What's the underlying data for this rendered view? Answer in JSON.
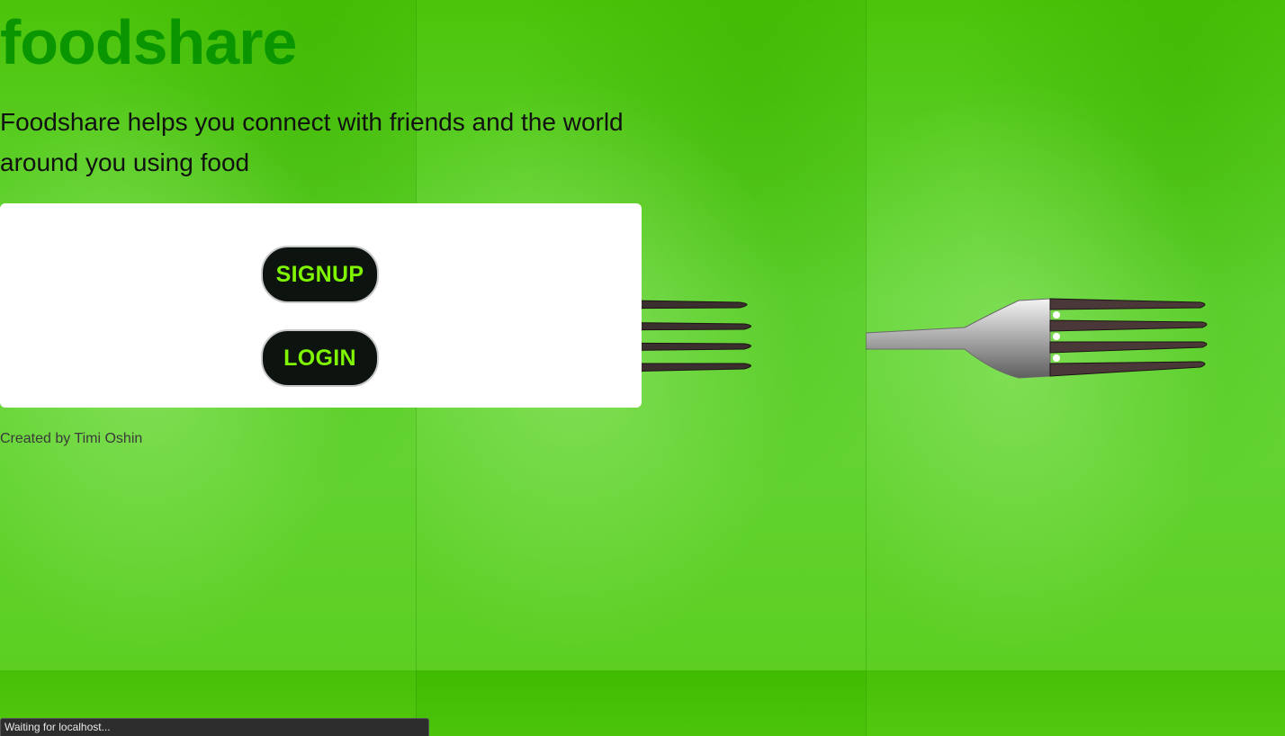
{
  "brand": "foodshare",
  "tagline": "Foodshare helps you connect with friends and the world around you using food",
  "buttons": {
    "signup": "SIGNUP",
    "login": "LOGIN"
  },
  "credit": "Created by Timi Oshin",
  "status_bar": "Waiting for localhost...",
  "colors": {
    "brand": "#0a9600",
    "button_bg": "#0d1410",
    "button_text": "#7ff500",
    "background": "#5ecf1c"
  },
  "background_image": "fork-on-green-photo"
}
